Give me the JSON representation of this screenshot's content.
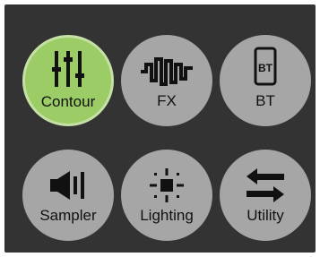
{
  "colors": {
    "panel_bg": "#333333",
    "tile_bg": "#a6a6a6",
    "tile_active_bg": "#9ccc65",
    "tile_active_ring": "#c5e1a5",
    "icon_color": "#111111"
  },
  "menu": {
    "items": [
      {
        "label": "Contour",
        "icon": "sliders-icon",
        "active": true
      },
      {
        "label": "FX",
        "icon": "waveform-icon",
        "active": false
      },
      {
        "label": "BT",
        "icon": "bluetooth-device-icon",
        "active": false
      },
      {
        "label": "Sampler",
        "icon": "speaker-icon",
        "active": false
      },
      {
        "label": "Lighting",
        "icon": "light-icon",
        "active": false
      },
      {
        "label": "Utility",
        "icon": "swap-arrows-icon",
        "active": false
      }
    ]
  }
}
